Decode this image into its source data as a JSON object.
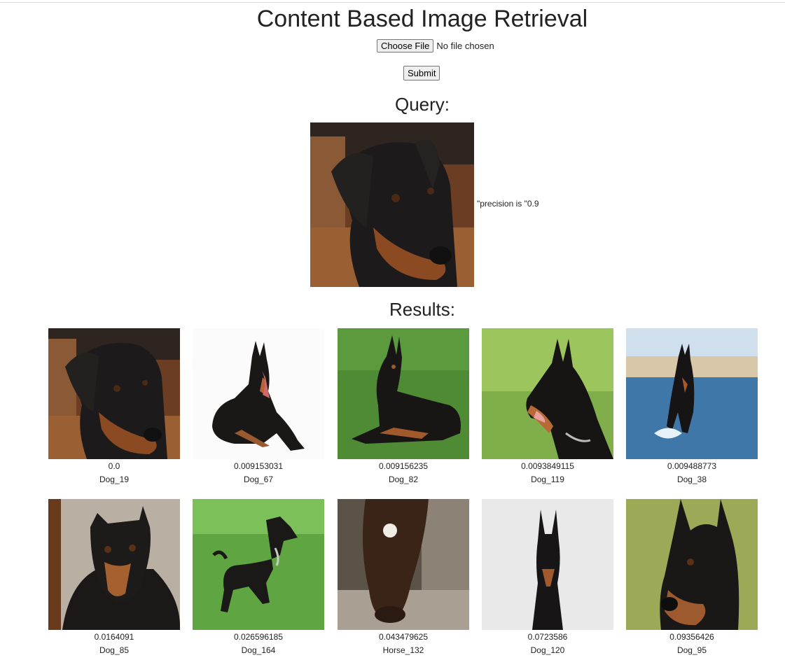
{
  "title": "Content Based Image Retrieval",
  "upload": {
    "choose_label": "Choose File",
    "status": "No file chosen",
    "submit_label": "Submit"
  },
  "query": {
    "heading": "Query:",
    "image_icon": "doberman-puppy-image",
    "precision_text": "\"precision is \"0.9"
  },
  "results": {
    "heading": "Results:",
    "items": [
      {
        "score": "0.0",
        "label": "Dog_19",
        "image_icon": "doberman-puppy-image"
      },
      {
        "score": "0.009153031",
        "label": "Dog_67",
        "image_icon": "doberman-lying-white-bg-image"
      },
      {
        "score": "0.009156235",
        "label": "Dog_82",
        "image_icon": "doberman-lying-grass-image"
      },
      {
        "score": "0.0093849115",
        "label": "Dog_119",
        "image_icon": "doberman-head-grass-image"
      },
      {
        "score": "0.009488773",
        "label": "Dog_38",
        "image_icon": "doberman-running-water-image"
      },
      {
        "score": "0.0164091",
        "label": "Dog_85",
        "image_icon": "doberman-blanket-gravel-image"
      },
      {
        "score": "0.026596185",
        "label": "Dog_164",
        "image_icon": "doberman-standing-grass-image"
      },
      {
        "score": "0.043479625",
        "label": "Horse_132",
        "image_icon": "horse-stable-image"
      },
      {
        "score": "0.0723586",
        "label": "Dog_120",
        "image_icon": "doberman-sitting-white-bg-image"
      },
      {
        "score": "0.09356426",
        "label": "Dog_95",
        "image_icon": "doberman-closeup-image"
      }
    ]
  }
}
